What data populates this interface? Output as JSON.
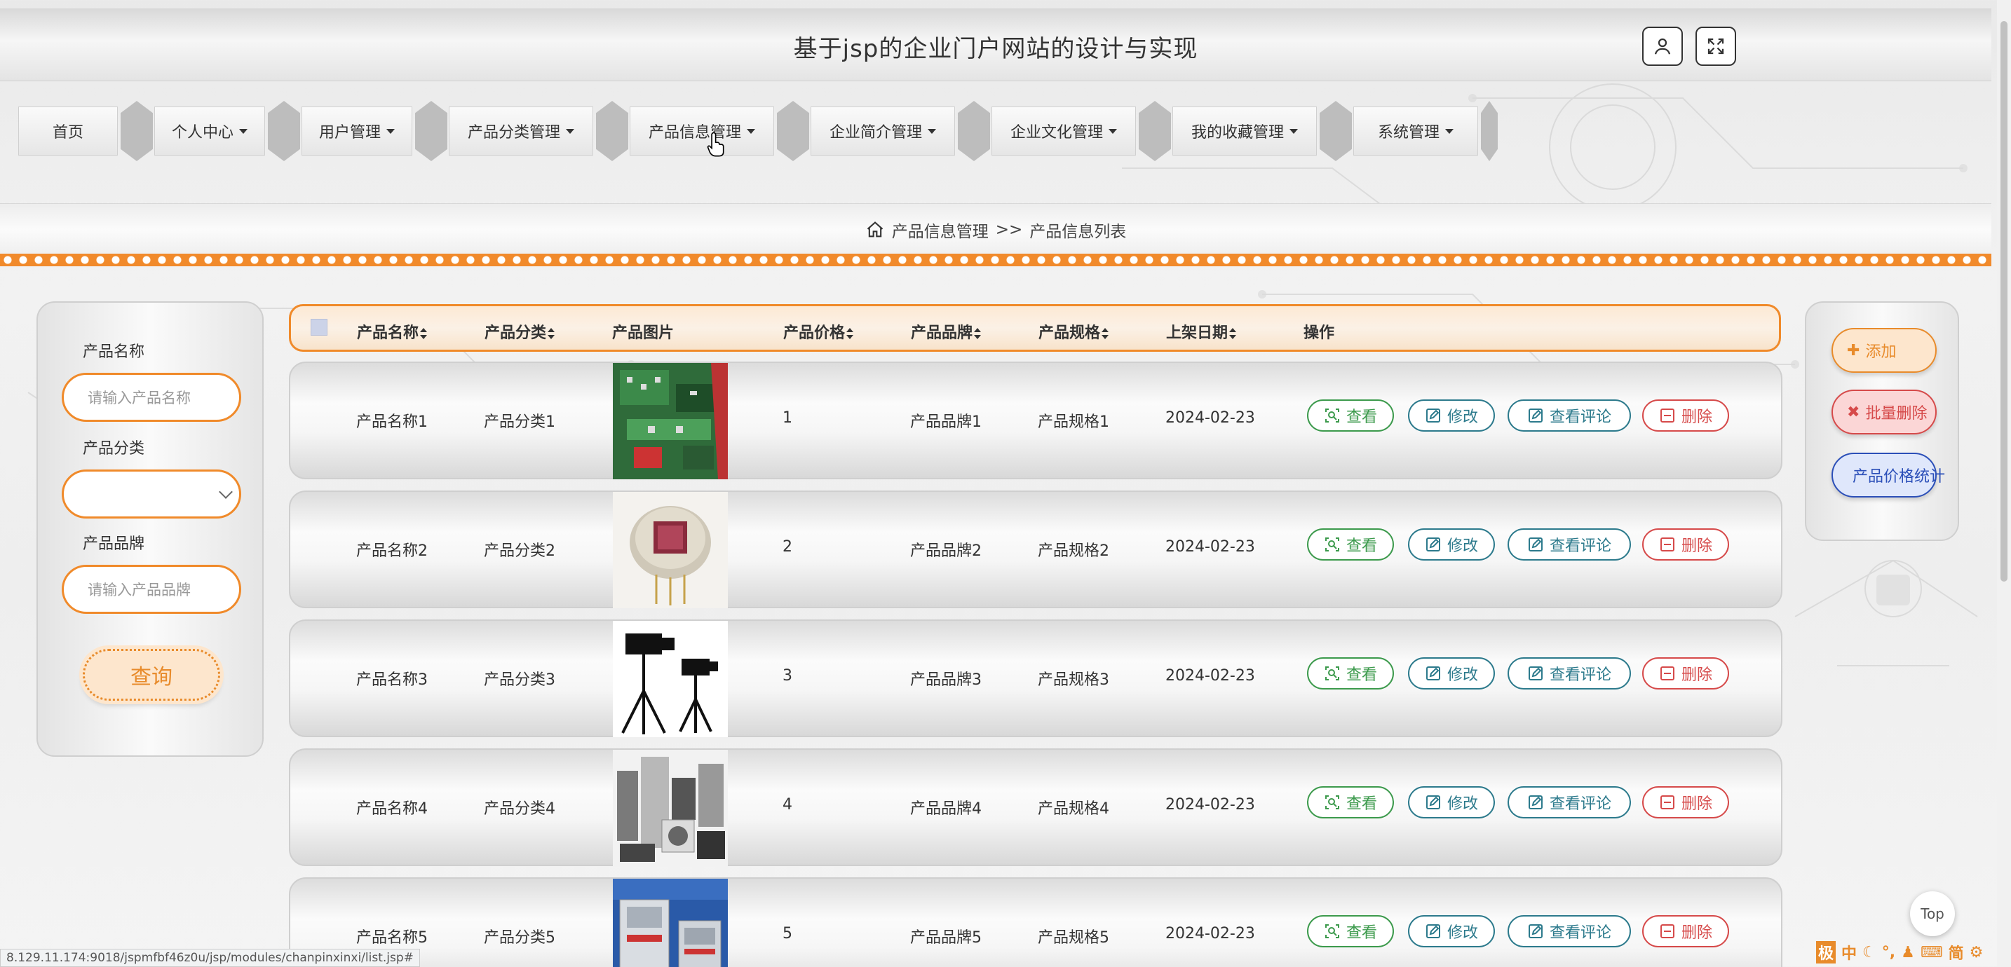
{
  "app_title": "基于jsp的企业门户网站的设计与实现",
  "nav": [
    {
      "label": "首页",
      "has_caret": false
    },
    {
      "label": "个人中心",
      "has_caret": true
    },
    {
      "label": "用户管理",
      "has_caret": true
    },
    {
      "label": "产品分类管理",
      "has_caret": true
    },
    {
      "label": "产品信息管理",
      "has_caret": true
    },
    {
      "label": "企业简介管理",
      "has_caret": true
    },
    {
      "label": "企业文化管理",
      "has_caret": true
    },
    {
      "label": "我的收藏管理",
      "has_caret": true
    },
    {
      "label": "系统管理",
      "has_caret": true
    }
  ],
  "breadcrumb": {
    "section": "产品信息管理",
    "separator": ">>",
    "page": "产品信息列表"
  },
  "search": {
    "name_label": "产品名称",
    "name_placeholder": "请输入产品名称",
    "category_label": "产品分类",
    "category_value": "",
    "brand_label": "产品品牌",
    "brand_placeholder": "请输入产品品牌",
    "query_button": "查询"
  },
  "table": {
    "columns": [
      "产品名称",
      "产品分类",
      "产品图片",
      "产品价格",
      "产品品牌",
      "产品规格",
      "上架日期",
      "操作"
    ],
    "rows": [
      {
        "name": "产品名称1",
        "category": "产品分类1",
        "image": "circuit-board",
        "price": "1",
        "brand": "产品品牌1",
        "spec": "产品规格1",
        "date": "2024-02-23"
      },
      {
        "name": "产品名称2",
        "category": "产品分类2",
        "image": "sensor",
        "price": "2",
        "brand": "产品品牌2",
        "spec": "产品规格2",
        "date": "2024-02-23"
      },
      {
        "name": "产品名称3",
        "category": "产品分类3",
        "image": "tripods",
        "price": "3",
        "brand": "产品品牌3",
        "spec": "产品规格3",
        "date": "2024-02-23"
      },
      {
        "name": "产品名称4",
        "category": "产品分类4",
        "image": "appliances",
        "price": "4",
        "brand": "产品品牌4",
        "spec": "产品规格4",
        "date": "2024-02-23"
      },
      {
        "name": "产品名称5",
        "category": "产品分类5",
        "image": "cabinets",
        "price": "5",
        "brand": "产品品牌5",
        "spec": "产品规格5",
        "date": "2024-02-23"
      }
    ],
    "actions": {
      "view": "查看",
      "edit": "修改",
      "comments": "查看评论",
      "delete": "删除"
    }
  },
  "side_actions": {
    "add": "添加",
    "batch_delete": "批量删除",
    "price_stats": "产品价格统计"
  },
  "status_url": "8.129.11.174:9018/jspmfbf46z0u/jsp/modules/chanpinxinxi/list.jsp#",
  "top_button": "Top",
  "ime": [
    "极",
    "中",
    "简"
  ],
  "colors": {
    "accent_orange": "#f08a2a",
    "view_green": "#3c9a4c",
    "edit_teal": "#2c7a8c",
    "delete_red": "#d64a4a",
    "stat_blue": "#2b4fb8"
  }
}
